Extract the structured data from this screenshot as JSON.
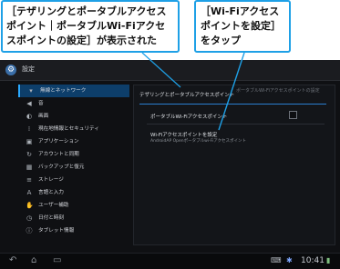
{
  "callouts": {
    "left": "［テザリングとポータブルアクセスポイント｜ポータブルWi-Fiアクセスポイントの設定］が表示された",
    "right": "［Wi-Fiアクセスポイントを設定］をタップ"
  },
  "app": {
    "title": "設定",
    "icon": "settings-gear-icon"
  },
  "nav": [
    {
      "label": "無線とネットワーク",
      "icon": "wireless-icon",
      "selected": true
    },
    {
      "label": "音",
      "icon": "sound-icon",
      "selected": false
    },
    {
      "label": "画面",
      "icon": "display-icon",
      "selected": false
    },
    {
      "label": "現在地情報とセキュリティ",
      "icon": "location-lock-icon",
      "selected": false
    },
    {
      "label": "アプリケーション",
      "icon": "apps-icon",
      "selected": false
    },
    {
      "label": "アカウントと同期",
      "icon": "sync-icon",
      "selected": false
    },
    {
      "label": "バックアップと復元",
      "icon": "backup-icon",
      "selected": false
    },
    {
      "label": "ストレージ",
      "icon": "storage-icon",
      "selected": false
    },
    {
      "label": "言語と入力",
      "icon": "language-icon",
      "selected": false
    },
    {
      "label": "ユーザー補助",
      "icon": "accessibility-icon",
      "selected": false
    },
    {
      "label": "日付と時刻",
      "icon": "clock-icon",
      "selected": false
    },
    {
      "label": "タブレット情報",
      "icon": "info-icon",
      "selected": false
    }
  ],
  "panel": {
    "header": "テザリングとポータブルアクセスポイント",
    "header_right": "ポータブルWi-Fiアクセスポイントの設定",
    "items": [
      {
        "title": "ポータブルWi-Fiアクセスポイント",
        "checked": false
      },
      {
        "title": "Wi-Fiアクセスポイントを設定",
        "subtitle": "AndroidAP Openポータブルwi-Fiアクセスポイント"
      }
    ]
  },
  "status": {
    "time": "10:41"
  }
}
